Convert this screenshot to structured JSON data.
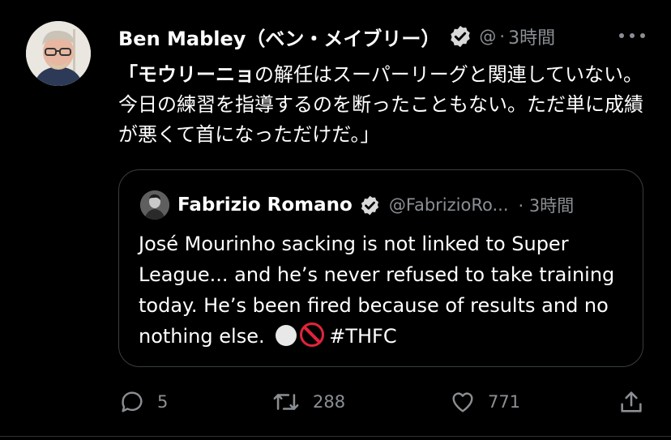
{
  "tweet": {
    "author_name": "Ben Mabley（ベン・メイブリー）",
    "handle": "@",
    "separator": "·",
    "time": "3時間",
    "text_bold": "「モウリーニョ",
    "text_rest": "の解任はスーパーリーグと関連していない。今日の練習を指導するのを断ったこともない。ただ単に成績が悪くて首になっただけだ。」"
  },
  "quote": {
    "author_name": "Fabrizio Romano",
    "handle": "@FabrizioRo...",
    "time": "· 3時間",
    "text": "José Mourinho sacking is not linked to Super League... and he’s never refused to take training today. He’s been fired because of results and no nothing else.",
    "emojis": [
      "white-circle",
      "prohibited"
    ],
    "hashtag": "#THFC"
  },
  "actions": {
    "replies": "5",
    "retweets": "288",
    "likes": "771"
  },
  "colors": {
    "background": "#000000",
    "text": "#ffffff",
    "secondary": "#8b8f94",
    "border": "#3a3d40"
  }
}
